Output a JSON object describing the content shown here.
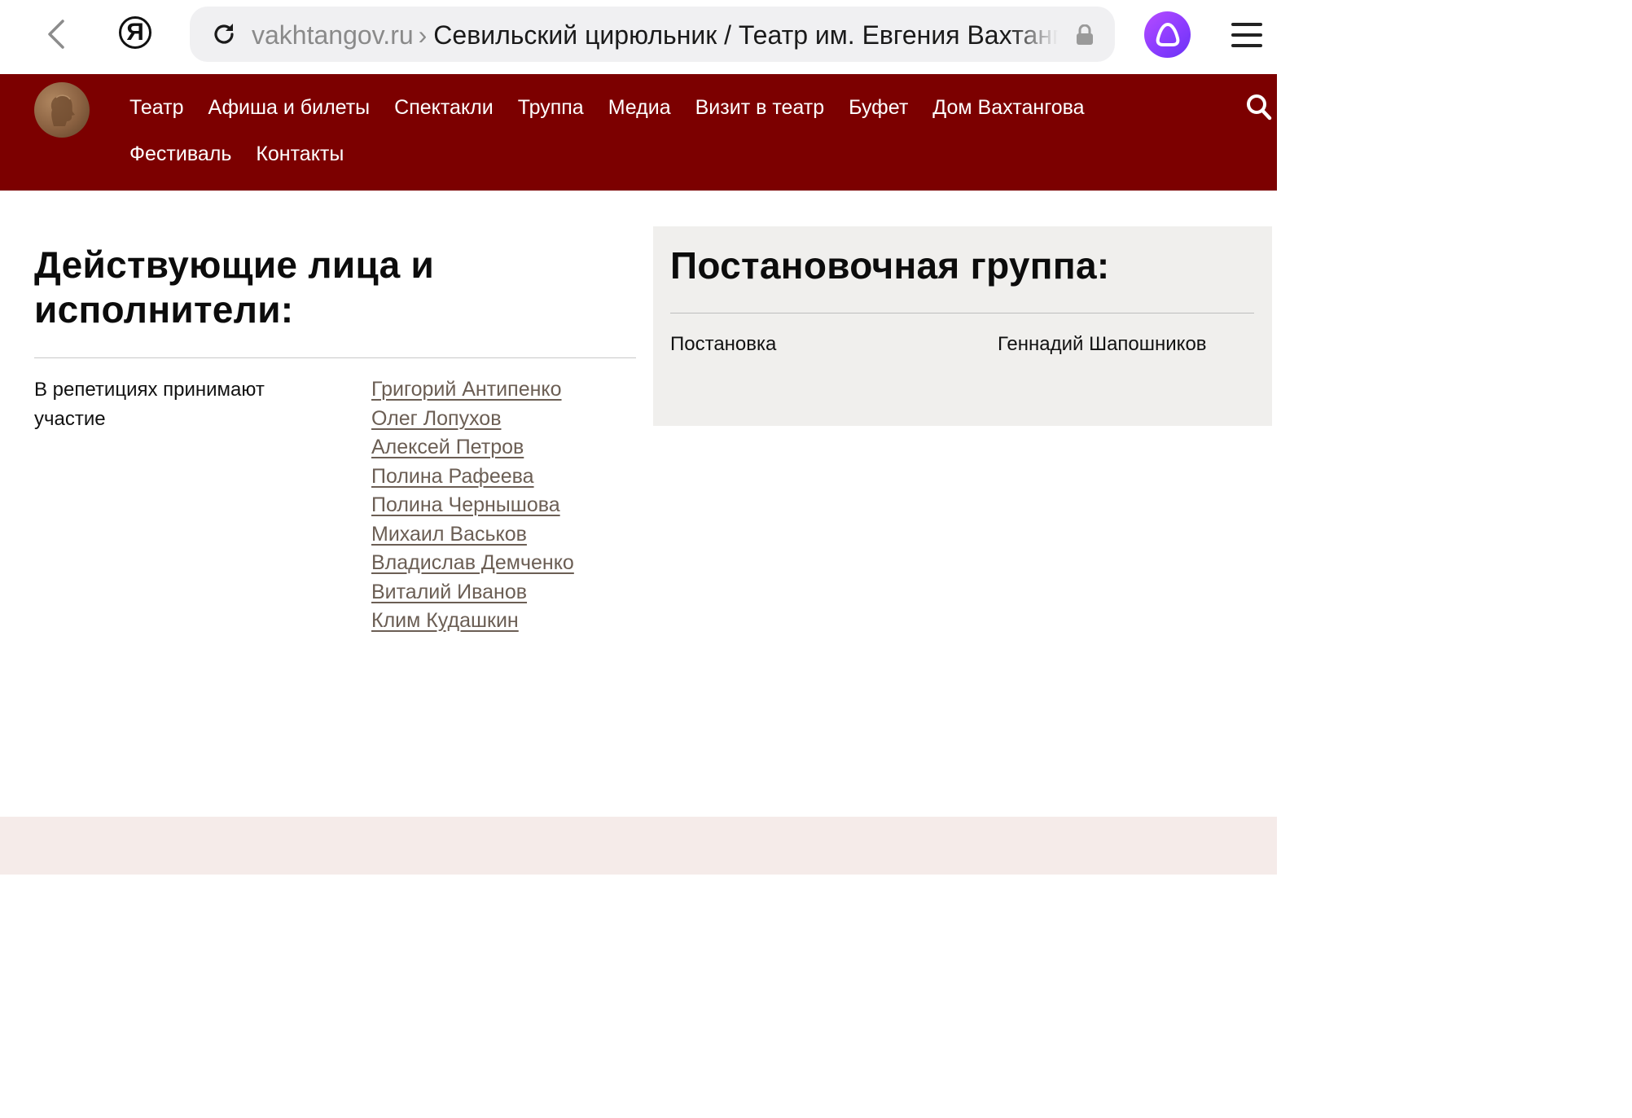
{
  "browser": {
    "url_domain": "vakhtangov.ru",
    "url_separator": "›",
    "page_title": "Севильский цирюльник / Театр им. Евгения Вахтангова",
    "logo_letter": "Я"
  },
  "header": {
    "nav_row_1": [
      "Театр",
      "Афиша и билеты",
      "Спектакли",
      "Труппа",
      "Медиа",
      "Визит в театр",
      "Буфет",
      "Дом Вахтангова"
    ],
    "nav_row_2": [
      "Фестиваль",
      "Контакты"
    ]
  },
  "cast": {
    "title": "Действующие лица и исполнители:",
    "role": "В репетициях принимают участие",
    "actors": [
      "Григорий Антипенко",
      "Олег Лопухов",
      "Алексей Петров",
      "Полина Рафеева",
      "Полина Чернышова",
      "Михаил Васьков",
      "Владислав Демченко",
      "Виталий Иванов",
      "Клим Кудашкин"
    ]
  },
  "crew": {
    "title": "Постановочная группа:",
    "items": [
      {
        "role": "Постановка",
        "person": "Геннадий Шапошников"
      }
    ]
  },
  "colors": {
    "header_bg": "#7c0000",
    "link": "#6b5e54",
    "panel_bg": "#f0efed",
    "footer_bg": "#f5ebe9",
    "alice": "#8b3cff"
  }
}
